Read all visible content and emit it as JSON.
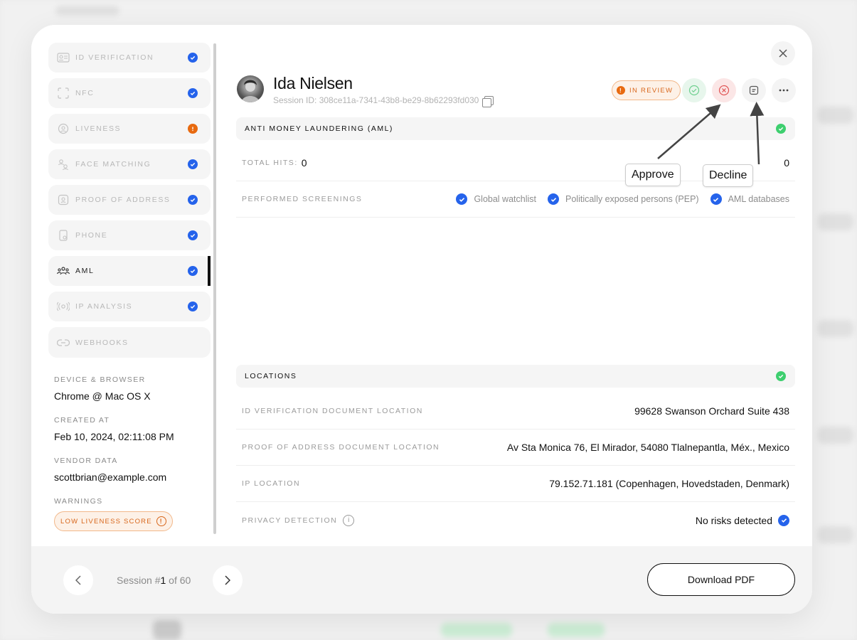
{
  "sidebar": {
    "items": [
      {
        "label": "ID VERIFICATION",
        "icon": "id-card-icon",
        "status": "ok"
      },
      {
        "label": "NFC",
        "icon": "nfc-scan-icon",
        "status": "ok"
      },
      {
        "label": "LIVENESS",
        "icon": "face-liveness-icon",
        "status": "warning"
      },
      {
        "label": "FACE MATCHING",
        "icon": "face-matching-icon",
        "status": "ok"
      },
      {
        "label": "PROOF OF ADDRESS",
        "icon": "address-icon",
        "status": "ok"
      },
      {
        "label": "PHONE",
        "icon": "phone-icon",
        "status": "ok"
      },
      {
        "label": "AML",
        "icon": "aml-icon",
        "status": "ok",
        "active": true
      },
      {
        "label": "IP ANALYSIS",
        "icon": "ip-analysis-icon",
        "status": "ok"
      },
      {
        "label": "WEBHOOKS",
        "icon": "link-icon",
        "status": ""
      }
    ],
    "meta": {
      "device_label": "DEVICE & BROWSER",
      "device_value": "Chrome @ Mac OS X",
      "created_label": "CREATED AT",
      "created_value": "Feb 10, 2024, 02:11:08 PM",
      "vendor_label": "VENDOR DATA",
      "vendor_value": "scottbrian@example.com",
      "warnings_label": "WARNINGS",
      "warning_badge": "LOW LIVENESS SCORE"
    }
  },
  "header": {
    "name": "Ida Nielsen",
    "session_id": "Session ID: 308ce11a-7341-43b8-be29-8b62293fd030",
    "status_badge": "IN REVIEW"
  },
  "aml": {
    "title": "ANTI MONEY LAUNDERING (AML)",
    "total_hits_label": "TOTAL HITS:",
    "total_hits_value": "0",
    "right_value": "0",
    "screenings_label": "PERFORMED SCREENINGS",
    "screenings": [
      "Global watchlist",
      "Politically exposed persons (PEP)",
      "AML databases"
    ]
  },
  "locations": {
    "title": "LOCATIONS",
    "rows": [
      {
        "label": "ID VERIFICATION DOCUMENT LOCATION",
        "value": "99628 Swanson Orchard Suite 438"
      },
      {
        "label": "PROOF OF ADDRESS DOCUMENT LOCATION",
        "value": "Av Sta Monica 76, El Mirador, 54080 Tlalnepantla, Méx., Mexico"
      },
      {
        "label": "IP LOCATION",
        "value": "79.152.71.181 (Copenhagen, Hovedstaden, Denmark)"
      },
      {
        "label": "PRIVACY DETECTION",
        "value": "No risks detected"
      }
    ]
  },
  "callouts": {
    "approve": "Approve",
    "decline": "Decline"
  },
  "footer": {
    "session_prefix": "Session #",
    "session_current": "1",
    "session_suffix": " of 60",
    "download_label": "Download PDF"
  },
  "colors": {
    "accent_blue": "#2563eb",
    "warning_orange": "#e86a10",
    "success_green": "#3ecf6f",
    "decline_red": "#e05555"
  }
}
